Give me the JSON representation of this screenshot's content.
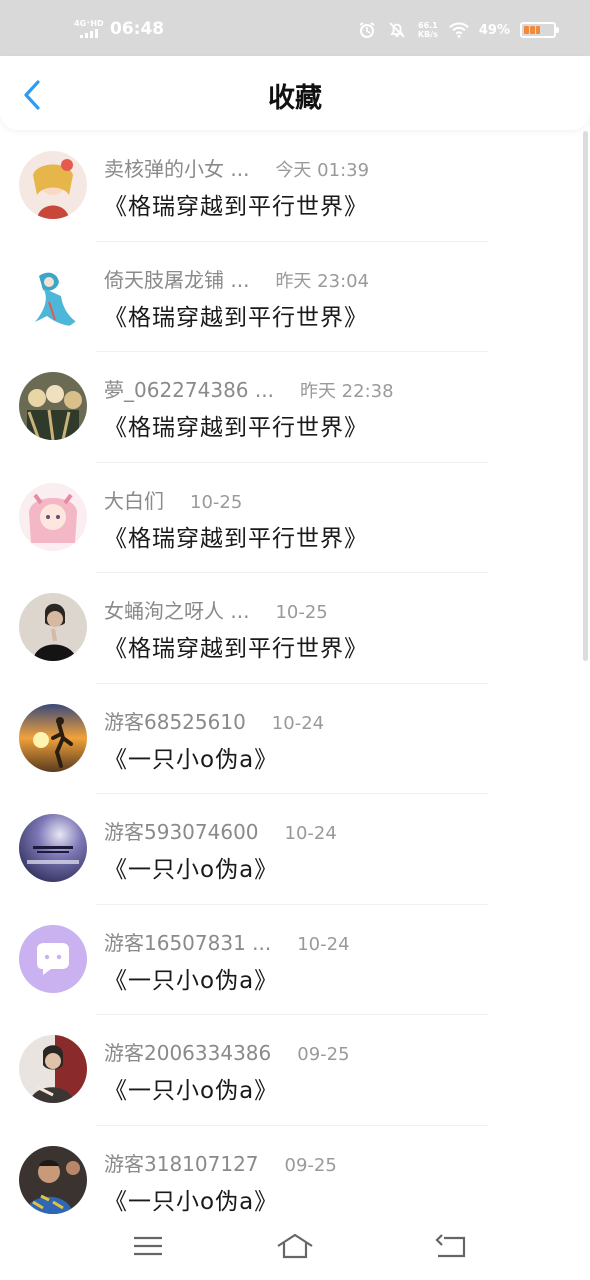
{
  "status_bar": {
    "network": "4G⁺HD",
    "time": "06:48",
    "speed_value": "66.1",
    "speed_unit": "KB/s",
    "battery_percent": "49%",
    "battery_level": 0.49,
    "icons": [
      "alarm-icon",
      "mute-icon",
      "wifi-icon",
      "battery-icon"
    ]
  },
  "header": {
    "title": "收藏",
    "back_icon": "chevron-left-icon"
  },
  "accent_color": "#2e9cf2",
  "favorites": [
    {
      "name": "卖核弹的小女 ...",
      "time": "今天 01:39",
      "title": "《格瑞穿越到平行世界》"
    },
    {
      "name": "倚天肢屠龙铺 ...",
      "time": "昨天 23:04",
      "title": "《格瑞穿越到平行世界》"
    },
    {
      "name": "夢_062274386 ...",
      "time": "昨天 22:38",
      "title": "《格瑞穿越到平行世界》"
    },
    {
      "name": "大白们",
      "time": "10-25",
      "title": "《格瑞穿越到平行世界》"
    },
    {
      "name": "女蛹洵之呀人 ...",
      "time": "10-25",
      "title": "《格瑞穿越到平行世界》"
    },
    {
      "name": "游客68525610",
      "time": "10-24",
      "title": "《一只小o伪a》"
    },
    {
      "name": "游客593074600",
      "time": "10-24",
      "title": "《一只小o伪a》"
    },
    {
      "name": "游客16507831 ...",
      "time": "10-24",
      "title": "《一只小o伪a》"
    },
    {
      "name": "游客2006334386",
      "time": "09-25",
      "title": "《一只小o伪a》"
    },
    {
      "name": "游客318107127",
      "time": "09-25",
      "title": "《一只小o伪a》"
    }
  ],
  "nav_bar": {
    "icons": [
      "menu-icon",
      "home-icon",
      "back-icon"
    ]
  }
}
